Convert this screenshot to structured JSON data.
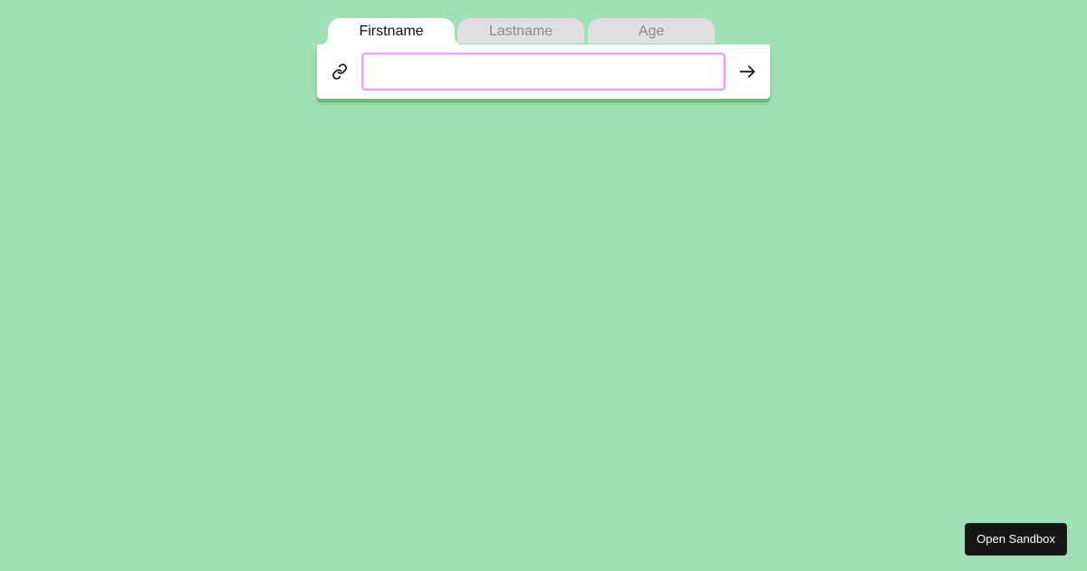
{
  "tabs": [
    {
      "label": "Firstname",
      "active": true
    },
    {
      "label": "Lastname",
      "active": false
    },
    {
      "label": "Age",
      "active": false
    }
  ],
  "input": {
    "value": "",
    "placeholder": ""
  },
  "icons": {
    "left": "link-icon",
    "right": "arrow-right-icon"
  },
  "sandbox_button": {
    "label": "Open Sandbox"
  },
  "colors": {
    "background": "#9fe1b4",
    "panel_accent": "#5fbf6f",
    "input_border": "#e3a8f0",
    "inactive_tab": "#e0e0e0",
    "button_bg": "#151515"
  }
}
